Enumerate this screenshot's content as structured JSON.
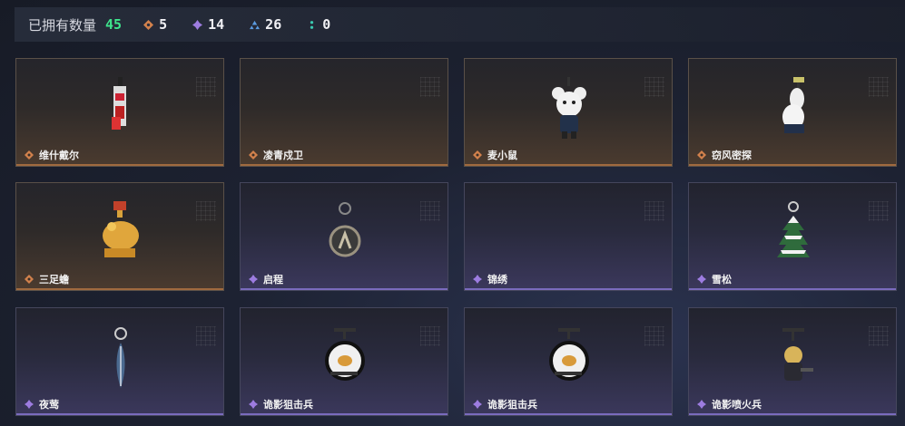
{
  "header": {
    "title": "已拥有数量",
    "owned_count": "45",
    "stats": [
      {
        "icon": "orange-diamond-icon",
        "value": "5",
        "color": "#d2814c"
      },
      {
        "icon": "purple-diamond-icon",
        "value": "14",
        "color": "#9d7ce0"
      },
      {
        "icon": "blue-triangle-icon",
        "value": "26",
        "color": "#5b9be0"
      },
      {
        "icon": "teal-dots-icon",
        "value": "0",
        "color": "#3bc9b0"
      }
    ]
  },
  "colors": {
    "count_green": "#3ee58c",
    "orange_rarity": "#d2814c",
    "purple_rarity": "#9d7ce0"
  },
  "items": [
    {
      "name": "维什戴尔",
      "rarity": "orange",
      "icon": "vishdyer-charm-icon"
    },
    {
      "name": "凌青戍卫",
      "rarity": "orange",
      "icon": "empty-slot"
    },
    {
      "name": "麦小鼠",
      "rarity": "orange",
      "icon": "mouse-charm-icon"
    },
    {
      "name": "窃风密探",
      "rarity": "orange",
      "icon": "rabbit-charm-icon"
    },
    {
      "name": "三足蟾",
      "rarity": "orange",
      "icon": "toad-charm-icon"
    },
    {
      "name": "启程",
      "rarity": "purple",
      "icon": "ring-charm-icon"
    },
    {
      "name": "锦绣",
      "rarity": "purple",
      "icon": "empty-slot"
    },
    {
      "name": "雪松",
      "rarity": "purple",
      "icon": "snow-pine-charm-icon"
    },
    {
      "name": "夜莺",
      "rarity": "purple",
      "icon": "feather-charm-icon"
    },
    {
      "name": "诡影狙击兵",
      "rarity": "purple",
      "icon": "sniper-charm-icon"
    },
    {
      "name": "诡影狙击兵",
      "rarity": "purple",
      "icon": "sniper-charm-icon"
    },
    {
      "name": "诡影喷火兵",
      "rarity": "purple",
      "icon": "flamethrower-charm-icon"
    }
  ]
}
